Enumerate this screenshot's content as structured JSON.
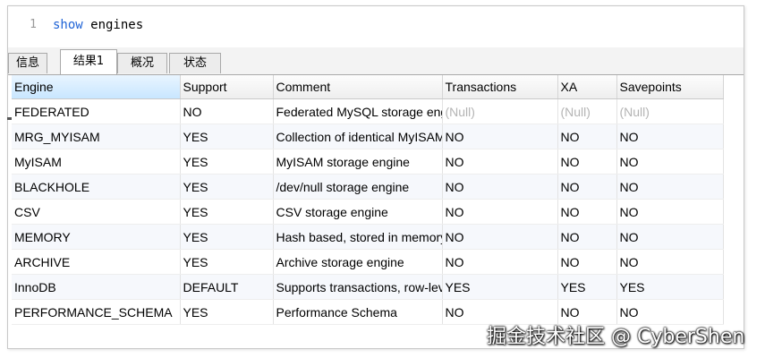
{
  "editor": {
    "line_number": "1",
    "keyword": "show",
    "argument": " engines"
  },
  "tabs": [
    {
      "label": "信息"
    },
    {
      "label": "结果1"
    },
    {
      "label": "概况"
    },
    {
      "label": "状态"
    }
  ],
  "grid": {
    "columns": [
      "Engine",
      "Support",
      "Comment",
      "Transactions",
      "XA",
      "Savepoints"
    ],
    "rows": [
      [
        "FEDERATED",
        "NO",
        "Federated MySQL storage engine",
        "(Null)",
        "(Null)",
        "(Null)"
      ],
      [
        "MRG_MYISAM",
        "YES",
        "Collection of identical MyISAM tables",
        "NO",
        "NO",
        "NO"
      ],
      [
        "MyISAM",
        "YES",
        "MyISAM storage engine",
        "NO",
        "NO",
        "NO"
      ],
      [
        "BLACKHOLE",
        "YES",
        "/dev/null storage engine",
        "NO",
        "NO",
        "NO"
      ],
      [
        "CSV",
        "YES",
        "CSV storage engine",
        "NO",
        "NO",
        "NO"
      ],
      [
        "MEMORY",
        "YES",
        "Hash based, stored in memory",
        "NO",
        "NO",
        "NO"
      ],
      [
        "ARCHIVE",
        "YES",
        "Archive storage engine",
        "NO",
        "NO",
        "NO"
      ],
      [
        "InnoDB",
        "DEFAULT",
        "Supports transactions, row-level locking",
        "YES",
        "YES",
        "YES"
      ],
      [
        "PERFORMANCE_SCHEMA",
        "YES",
        "Performance Schema",
        "NO",
        "NO",
        "NO"
      ]
    ]
  },
  "watermark": "掘金技术社区 @ CyberShen"
}
